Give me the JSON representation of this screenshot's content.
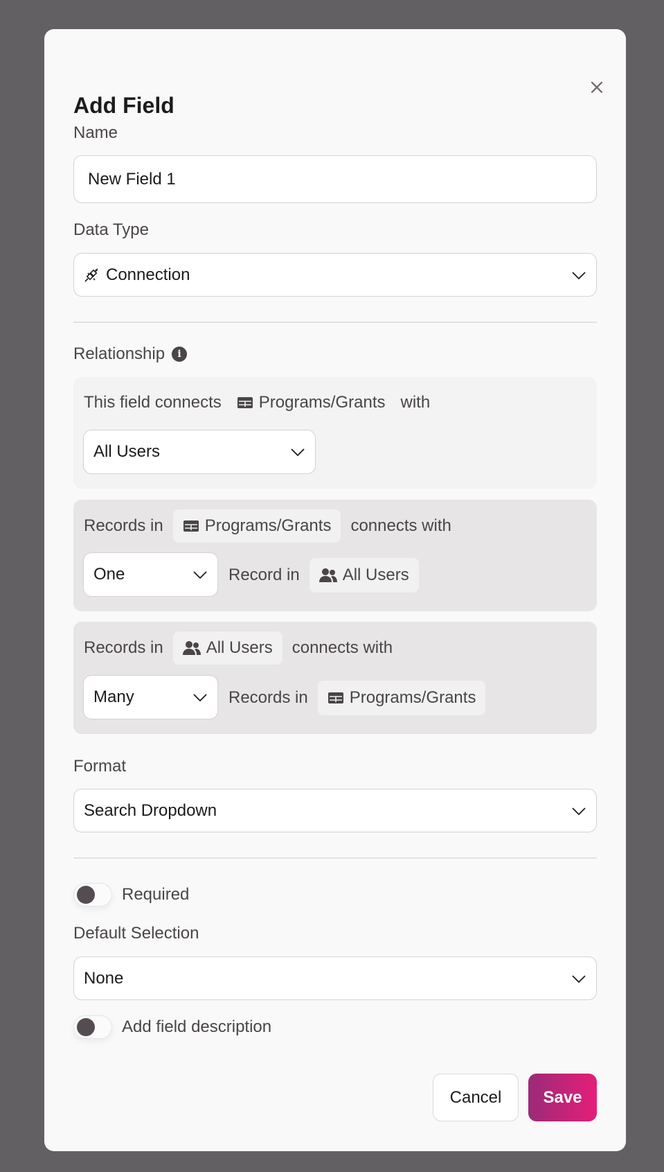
{
  "dialog": {
    "title": "Add Field",
    "close_icon": "close-icon"
  },
  "name": {
    "label": "Name",
    "value": "New Field 1"
  },
  "data_type": {
    "label": "Data Type",
    "value": "Connection",
    "icon": "plug-icon"
  },
  "relationship": {
    "label": "Relationship",
    "info_icon": "info-icon",
    "intro": {
      "prefix": "This field connects",
      "table": "Programs/Grants",
      "suffix": "with",
      "select_value": "All Users"
    },
    "rule1": {
      "prefix": "Records in",
      "table": "Programs/Grants",
      "connects": "connects with",
      "count": "One",
      "target_label": "Record in",
      "target": "All Users"
    },
    "rule2": {
      "prefix": "Records in",
      "table": "All Users",
      "connects": "connects with",
      "count": "Many",
      "target_label": "Records in",
      "target": "Programs/Grants"
    }
  },
  "format": {
    "label": "Format",
    "value": "Search Dropdown"
  },
  "required": {
    "label": "Required",
    "on": false
  },
  "default_selection": {
    "label": "Default Selection",
    "value": "None"
  },
  "description": {
    "label": "Add field description",
    "on": false
  },
  "actions": {
    "cancel": "Cancel",
    "save": "Save"
  },
  "colors": {
    "save_gradient_start": "#9b2a78",
    "save_gradient_end": "#e61e78",
    "knob": "#544c51"
  }
}
